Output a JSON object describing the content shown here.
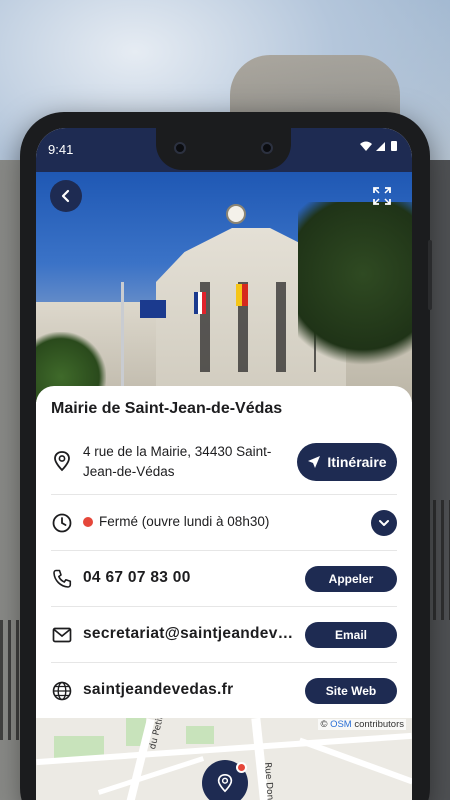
{
  "status_bar": {
    "time": "9:41",
    "icons": "▾◢▮"
  },
  "place": {
    "title": "Mairie de Saint-Jean-de-Védas",
    "address_line1": "4 rue de la Mairie, 34430 Saint-",
    "address_line2": "Jean-de-Védas",
    "hours_status": "Fermé (ouvre lundi à 08h30)",
    "status_color": "#e5473a",
    "phone": "04 67 07 83 00",
    "email": "secretariat@saintjeandev…",
    "website": "saintjeandevedas.fr"
  },
  "actions": {
    "itinerary_label": "Itinéraire",
    "call_label": "Appeler",
    "email_label": "Email",
    "website_label": "Site Web"
  },
  "map": {
    "attribution_prefix": "©",
    "attribution_link": "OSM",
    "attribution_suffix": "contributors",
    "street_labels": [
      "du Petit Prader",
      "Rue Don"
    ]
  },
  "icons": {
    "back": "arrow-left-icon",
    "expand": "expand-icon",
    "location": "location-pin-icon",
    "navigate": "navigation-arrow-icon",
    "clock": "clock-icon",
    "chevron": "chevron-down-icon",
    "phone": "phone-icon",
    "mail": "mail-icon",
    "globe": "globe-icon"
  },
  "colors": {
    "primary": "#1e2b52",
    "closed_dot": "#e5473a",
    "osm_link": "#2a6fd6"
  }
}
